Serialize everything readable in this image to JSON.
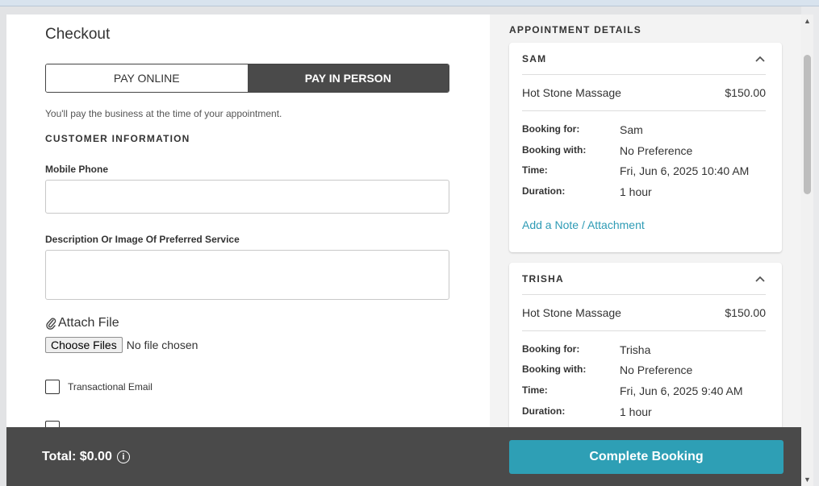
{
  "checkout": {
    "title": "Checkout",
    "pay_online": "PAY ONLINE",
    "pay_in_person": "PAY IN PERSON",
    "pay_note": "You'll pay the business at the time of your appointment.",
    "customer_info_heading": "CUSTOMER INFORMATION",
    "mobile_label": "Mobile Phone",
    "mobile_value": "",
    "description_label": "Description Or Image Of Preferred Service",
    "description_value": "",
    "attach_label": "Attach File",
    "choose_files": "Choose Files",
    "no_file": "No file chosen",
    "checkbox_1": "Transactional Email",
    "checkbox_1_checked": false
  },
  "appointments": {
    "heading": "APPOINTMENT DETAILS",
    "cards": [
      {
        "name": "SAM",
        "service": "Hot Stone Massage",
        "price": "$150.00",
        "booking_for_label": "Booking for:",
        "booking_for": "Sam",
        "booking_with_label": "Booking with:",
        "booking_with": "No Preference",
        "time_label": "Time:",
        "time": "Fri, Jun 6, 2025 10:40 AM",
        "duration_label": "Duration:",
        "duration": "1 hour",
        "add_note": "Add a Note / Attachment"
      },
      {
        "name": "TRISHA",
        "service": "Hot Stone Massage",
        "price": "$150.00",
        "booking_for_label": "Booking for:",
        "booking_for": "Trisha",
        "booking_with_label": "Booking with:",
        "booking_with": "No Preference",
        "time_label": "Time:",
        "time": "Fri, Jun 6, 2025 9:40 AM",
        "duration_label": "Duration:",
        "duration": "1 hour"
      }
    ]
  },
  "footer": {
    "total": "Total: $0.00",
    "complete_button": "Complete Booking"
  },
  "icons": {
    "info": "info-icon",
    "chevron": "chevron-up-icon",
    "paperclip": "paperclip-icon"
  },
  "colors": {
    "accent": "#2e9fb5",
    "dark": "#4a4a4a",
    "link": "#2e9bb5"
  }
}
